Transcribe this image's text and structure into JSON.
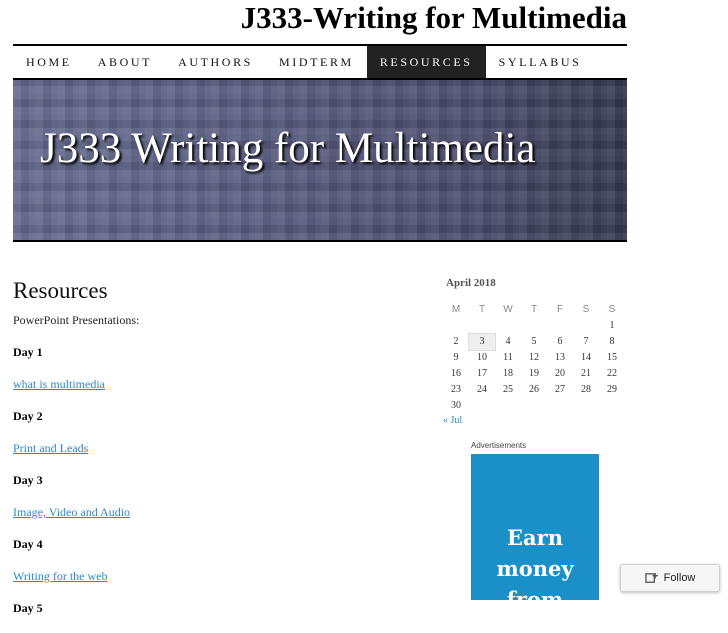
{
  "site": {
    "title": "J333-Writing for Multimedia"
  },
  "nav": {
    "items": [
      "HOME",
      "ABOUT",
      "AUTHORS",
      "MIDTERM",
      "RESOURCES",
      "SYLLABUS"
    ],
    "active": "RESOURCES"
  },
  "header": {
    "image_text": "J333 Writing for Multimedia"
  },
  "page": {
    "title": "Resources",
    "intro": "PowerPoint Presentations:",
    "sections": [
      {
        "day": "Day 1",
        "link": "what is multimedia"
      },
      {
        "day": "Day 2",
        "link": "Print and Leads"
      },
      {
        "day": "Day 3",
        "link": "Image, Video and Audio"
      },
      {
        "day": "Day 4",
        "link": "Writing for the web"
      },
      {
        "day": "Day 5",
        "link": ""
      }
    ]
  },
  "calendar": {
    "caption": "April 2018",
    "weekdays": [
      "M",
      "T",
      "W",
      "T",
      "F",
      "S",
      "S"
    ],
    "weeks": [
      [
        "",
        "",
        "",
        "",
        "",
        "",
        "1"
      ],
      [
        "2",
        "3",
        "4",
        "5",
        "6",
        "7",
        "8"
      ],
      [
        "9",
        "10",
        "11",
        "12",
        "13",
        "14",
        "15"
      ],
      [
        "16",
        "17",
        "18",
        "19",
        "20",
        "21",
        "22"
      ],
      [
        "23",
        "24",
        "25",
        "26",
        "27",
        "28",
        "29"
      ],
      [
        "30",
        "",
        "",
        "",
        "",
        "",
        ""
      ]
    ],
    "today": "3",
    "prev_link": "« Jul"
  },
  "ads": {
    "label": "Advertisements",
    "text": "Earn money from"
  },
  "follow": {
    "label": "Follow"
  },
  "colors": {
    "link": "#2a8ac9",
    "ad_background": "#1b8fc7",
    "nav_active_bg": "#222222"
  }
}
